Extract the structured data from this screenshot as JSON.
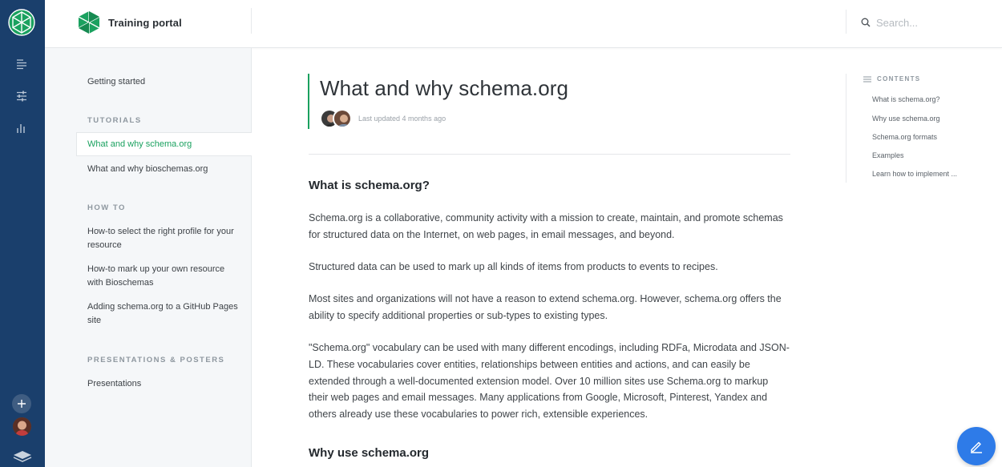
{
  "app": {
    "title": "Training portal"
  },
  "search": {
    "placeholder": "Search..."
  },
  "sidebar": {
    "getting_started": "Getting started",
    "sections": [
      {
        "heading": "TUTORIALS",
        "items": [
          "What and why schema.org",
          "What and why bioschemas.org"
        ]
      },
      {
        "heading": "HOW TO",
        "items": [
          "How-to select the right profile for your resource",
          "How-to mark up your own resource with Bioschemas",
          "Adding schema.org to a GitHub Pages site"
        ]
      },
      {
        "heading": "PRESENTATIONS & POSTERS",
        "items": [
          "Presentations"
        ]
      }
    ]
  },
  "page": {
    "title": "What and why schema.org",
    "last_updated": "Last updated 4 months ago",
    "sections": [
      {
        "heading": "What is schema.org?",
        "paragraphs": [
          "Schema.org is a collaborative, community activity with a mission to create, maintain, and promote schemas for structured data on the Internet, on web pages, in email messages, and beyond.",
          "Structured data can be used to mark up all kinds of items from products to events to recipes.",
          "Most sites and organizations will not have a reason to extend schema.org. However, schema.org offers the ability to specify additional properties or sub-types to existing types.",
          "\"Schema.org\" vocabulary can be used with many different encodings, including RDFa, Microdata and JSON-LD. These vocabularies cover entities, relationships between entities and actions, and can easily be extended through a well-documented extension model. Over 10 million sites use Schema.org to markup their web pages and email messages. Many applications from Google, Microsoft, Pinterest, Yandex and others already use these vocabularies to power rich, extensible experiences."
        ]
      },
      {
        "heading": "Why use schema.org"
      }
    ]
  },
  "toc": {
    "heading": "CONTENTS",
    "items": [
      "What is schema.org?",
      "Why use schema.org",
      "Schema.org formats",
      "Examples",
      "Learn how to implement ..."
    ]
  },
  "colors": {
    "rail": "#1a3f6c",
    "accent": "#1aa15f",
    "fab": "#2e7be8"
  },
  "icons": {
    "rail": [
      "app-logo-icon",
      "document-list-icon",
      "sliders-icon",
      "bar-chart-icon",
      "plus-icon",
      "user-avatar",
      "layers-icon"
    ],
    "header": [
      "brand-logo-icon",
      "search-icon"
    ],
    "fab": "edit-pencil-icon"
  }
}
